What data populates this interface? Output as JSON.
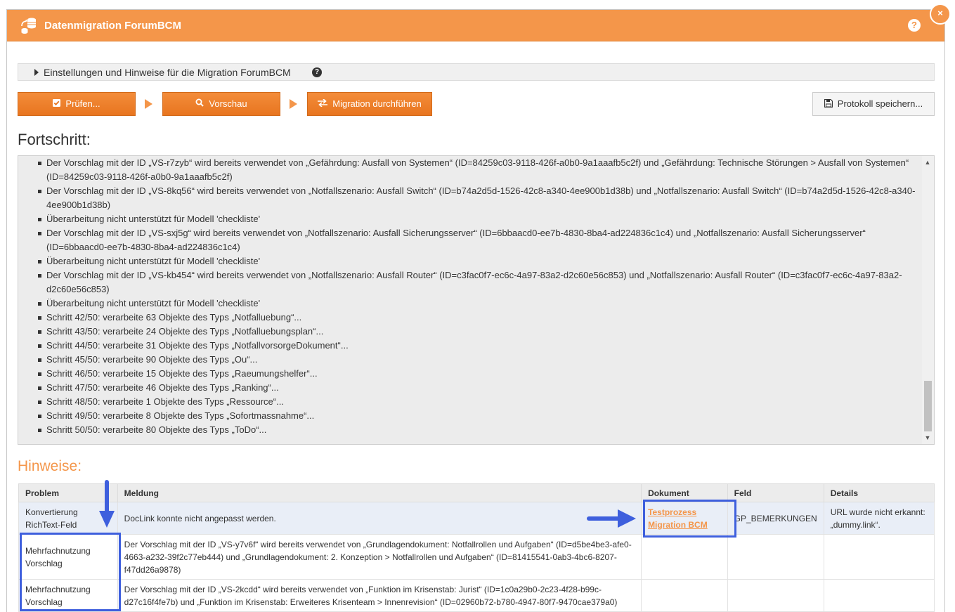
{
  "window": {
    "title": "Datenmigration ForumBCM",
    "help_label": "?",
    "close_label": "×"
  },
  "settings": {
    "label": "Einstellungen und Hinweise für die Migration ForumBCM",
    "help_icon": "?"
  },
  "toolbar": {
    "check_label": "Prüfen...",
    "preview_label": "Vorschau",
    "migrate_label": "Migration durchführen",
    "save_log_label": "Protokoll speichern..."
  },
  "progress": {
    "heading": "Fortschritt:",
    "lines": [
      "Der Vorschlag mit der ID „VS-r7zyb“ wird bereits verwendet von „Gefährdung: Ausfall von Systemen“ (ID=84259c03-9118-426f-a0b0-9a1aaafb5c2f) und „Gefährdung: Technische Störungen > Ausfall von Systemen“ (ID=84259c03-9118-426f-a0b0-9a1aaafb5c2f)",
      "Der Vorschlag mit der ID „VS-8kq56“ wird bereits verwendet von „Notfallszenario: Ausfall Switch“ (ID=b74a2d5d-1526-42c8-a340-4ee900b1d38b) und „Notfallszenario: Ausfall Switch“ (ID=b74a2d5d-1526-42c8-a340-4ee900b1d38b)",
      "Überarbeitung nicht unterstützt für Modell 'checkliste'",
      "Der Vorschlag mit der ID „VS-sxj5g“ wird bereits verwendet von „Notfallszenario: Ausfall Sicherungsserver“ (ID=6bbaacd0-ee7b-4830-8ba4-ad224836c1c4) und „Notfallszenario: Ausfall Sicherungsserver“ (ID=6bbaacd0-ee7b-4830-8ba4-ad224836c1c4)",
      "Überarbeitung nicht unterstützt für Modell 'checkliste'",
      "Der Vorschlag mit der ID „VS-kb454“ wird bereits verwendet von „Notfallszenario: Ausfall Router“ (ID=c3fac0f7-ec6c-4a97-83a2-d2c60e56c853) und „Notfallszenario: Ausfall Router“ (ID=c3fac0f7-ec6c-4a97-83a2-d2c60e56c853)",
      "Überarbeitung nicht unterstützt für Modell 'checkliste'",
      "Schritt 42/50: verarbeite 63 Objekte des Typs „Notfalluebung“...",
      "Schritt 43/50: verarbeite 24 Objekte des Typs „Notfalluebungsplan“...",
      "Schritt 44/50: verarbeite 31 Objekte des Typs „NotfallvorsorgeDokument“...",
      "Schritt 45/50: verarbeite 90 Objekte des Typs „Ou“...",
      "Schritt 46/50: verarbeite 15 Objekte des Typs „Raeumungshelfer“...",
      "Schritt 47/50: verarbeite 46 Objekte des Typs „Ranking“...",
      "Schritt 48/50: verarbeite 1 Objekte des Typs „Ressource“...",
      "Schritt 49/50: verarbeite 8 Objekte des Typs „Sofortmassnahme“...",
      "Schritt 50/50: verarbeite 80 Objekte des Typs „ToDo“..."
    ]
  },
  "hints": {
    "heading": "Hinweise:",
    "columns": [
      "Problem",
      "Meldung",
      "Dokument",
      "Feld",
      "Details"
    ],
    "rows": [
      {
        "problem": "Konvertierung RichText-Feld",
        "message": "DocLink konnte nicht angepasst werden.",
        "document": "Testprozess Migration BCM",
        "field": "GP_BEMERKUNGEN",
        "details": "URL wurde nicht erkannt: „dummy.link“."
      },
      {
        "problem": "Mehrfachnutzung Vorschlag",
        "message": "Der Vorschlag mit der ID „VS-y7v6f“ wird bereits verwendet von „Grundlagendokument: Notfallrollen und Aufgaben“ (ID=d5be4be3-afe0-4663-a232-39f2c77eb444) und „Grundlagendokument: 2. Konzeption > Notfallrollen und Aufgaben“ (ID=81415541-0ab3-4bc6-8207-f47dd26a9878)",
        "document": "",
        "field": "",
        "details": ""
      },
      {
        "problem": "Mehrfachnutzung Vorschlag",
        "message": "Der Vorschlag mit der ID „VS-2kcdd“ wird bereits verwendet von „Funktion im Krisenstab: Jurist“ (ID=1c0a29b0-2c23-4f28-b99c-d27c16f4fe7b) und „Funktion im Krisenstab: Erweiteres Krisenteam > Innenrevision“ (ID=02960b72-b780-4947-80f7-9470cae379a0)",
        "document": "",
        "field": "",
        "details": ""
      }
    ]
  },
  "colors": {
    "accent": "#f4964a",
    "highlight": "#3e5fdd"
  }
}
